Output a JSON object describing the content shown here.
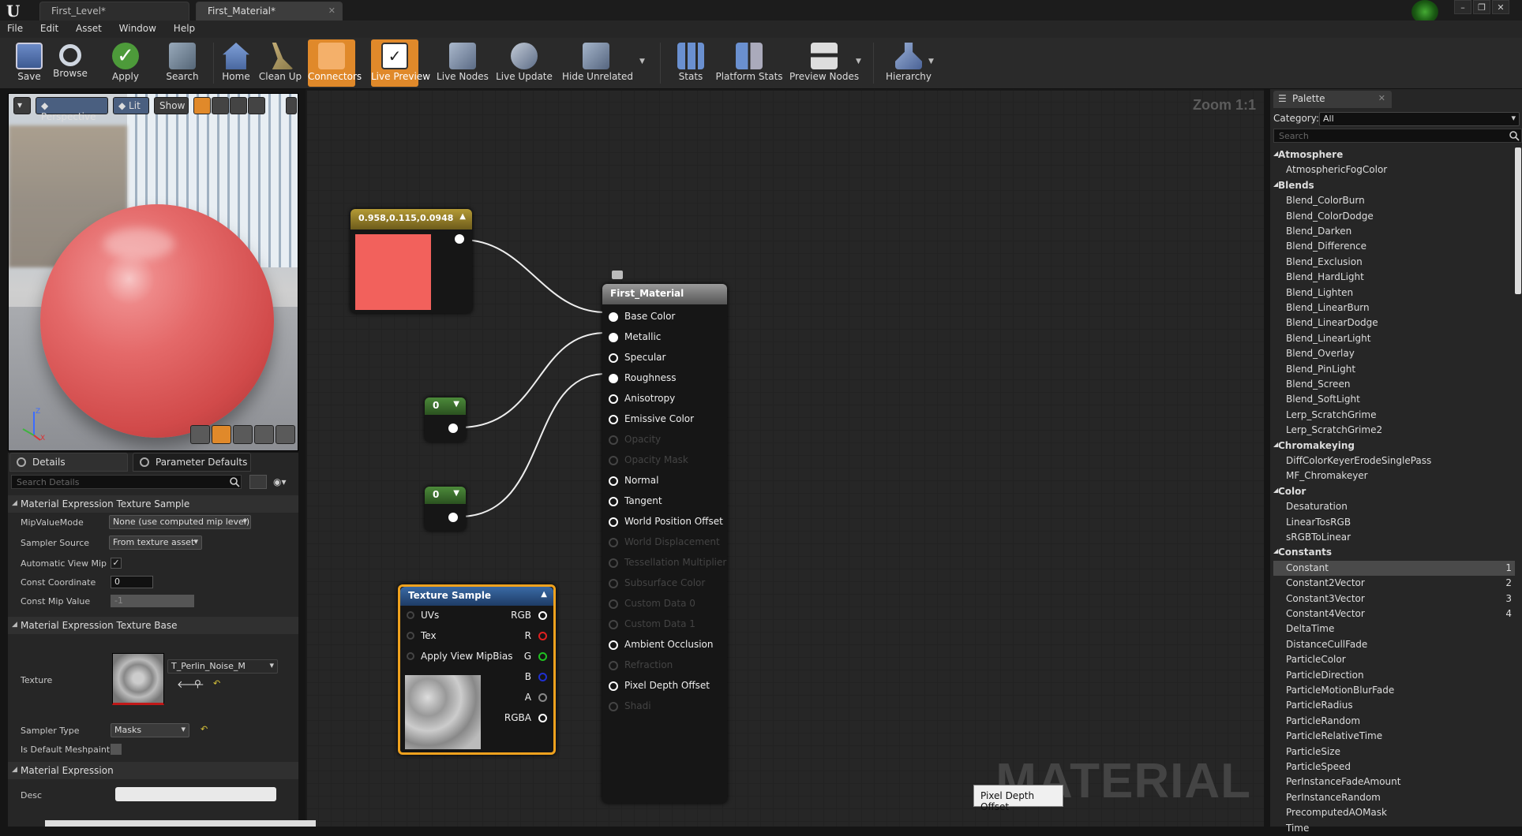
{
  "tabs": [
    {
      "label": "First_Level*"
    },
    {
      "label": "First_Material*"
    }
  ],
  "menu": [
    "File",
    "Edit",
    "Asset",
    "Window",
    "Help"
  ],
  "toolbar": {
    "save": "Save",
    "browse": "Browse",
    "apply": "Apply",
    "search": "Search",
    "home": "Home",
    "cleanup": "Clean Up",
    "connectors": "Connectors",
    "live_preview": "Live Preview",
    "live_nodes": "Live Nodes",
    "live_update": "Live Update",
    "hide_unrelated": "Hide Unrelated",
    "stats": "Stats",
    "platform_stats": "Platform Stats",
    "preview_nodes": "Preview Nodes",
    "hierarchy": "Hierarchy"
  },
  "viewport": {
    "perspective": "Perspective",
    "lit": "Lit",
    "show": "Show"
  },
  "details": {
    "tab_details": "Details",
    "tab_params": "Parameter Defaults",
    "search_placeholder": "Search Details",
    "sec_texture_sample": "Material Expression Texture Sample",
    "mip_value_mode": {
      "label": "MipValueMode",
      "value": "None (use computed mip level)"
    },
    "sampler_source": {
      "label": "Sampler Source",
      "value": "From texture asset"
    },
    "auto_view_mip": {
      "label": "Automatic View Mip E",
      "checked": "✓"
    },
    "const_coordinate": {
      "label": "Const Coordinate",
      "value": "0"
    },
    "const_mip_value": {
      "label": "Const Mip Value",
      "value": "-1"
    },
    "sec_texture_base": "Material Expression Texture Base",
    "texture": {
      "label": "Texture",
      "value": "T_Perlin_Noise_M"
    },
    "sampler_type": {
      "label": "Sampler Type",
      "value": "Masks"
    },
    "is_default_meshpaint": {
      "label": "Is Default Meshpaint"
    },
    "sec_material_expression": "Material Expression",
    "desc": {
      "label": "Desc"
    }
  },
  "graph": {
    "zoom": "Zoom 1:1",
    "watermark": "MATERIAL",
    "color_node_title": "0.958,0.115,0.0948",
    "constant_color": "#f2615c",
    "const1_value": "0",
    "const2_value": "0",
    "result_node": {
      "title": "First_Material",
      "pins": [
        {
          "label": "Base Color",
          "active": true,
          "connected": true
        },
        {
          "label": "Metallic",
          "active": true,
          "connected": true
        },
        {
          "label": "Specular",
          "active": true,
          "connected": false
        },
        {
          "label": "Roughness",
          "active": true,
          "connected": true
        },
        {
          "label": "Anisotropy",
          "active": true,
          "connected": false
        },
        {
          "label": "Emissive Color",
          "active": true,
          "connected": false
        },
        {
          "label": "Opacity",
          "active": false
        },
        {
          "label": "Opacity Mask",
          "active": false
        },
        {
          "label": "Normal",
          "active": true,
          "connected": false
        },
        {
          "label": "Tangent",
          "active": true,
          "connected": false
        },
        {
          "label": "World Position Offset",
          "active": true,
          "connected": false
        },
        {
          "label": "World Displacement",
          "active": false
        },
        {
          "label": "Tessellation Multiplier",
          "active": false
        },
        {
          "label": "Subsurface Color",
          "active": false
        },
        {
          "label": "Custom Data 0",
          "active": false
        },
        {
          "label": "Custom Data 1",
          "active": false
        },
        {
          "label": "Ambient Occlusion",
          "active": true,
          "connected": false
        },
        {
          "label": "Refraction",
          "active": false
        },
        {
          "label": "Pixel Depth Offset",
          "active": true,
          "connected": false
        },
        {
          "label": "Shadi",
          "active": false
        }
      ]
    },
    "texture_node": {
      "title": "Texture Sample",
      "inputs": [
        "UVs",
        "Tex",
        "Apply View MipBias"
      ],
      "outputs": [
        "RGB",
        "R",
        "G",
        "B",
        "A",
        "RGBA"
      ]
    },
    "tooltip": "Pixel Depth Offset"
  },
  "palette": {
    "tab": "Palette",
    "category_label": "Category:",
    "category_value": "All",
    "search_placeholder": "Search",
    "rows": [
      {
        "type": "cat",
        "label": "Atmosphere"
      },
      {
        "type": "item",
        "label": "AtmosphericFogColor"
      },
      {
        "type": "cat",
        "label": "Blends"
      },
      {
        "type": "item",
        "label": "Blend_ColorBurn"
      },
      {
        "type": "item",
        "label": "Blend_ColorDodge"
      },
      {
        "type": "item",
        "label": "Blend_Darken"
      },
      {
        "type": "item",
        "label": "Blend_Difference"
      },
      {
        "type": "item",
        "label": "Blend_Exclusion"
      },
      {
        "type": "item",
        "label": "Blend_HardLight"
      },
      {
        "type": "item",
        "label": "Blend_Lighten"
      },
      {
        "type": "item",
        "label": "Blend_LinearBurn"
      },
      {
        "type": "item",
        "label": "Blend_LinearDodge"
      },
      {
        "type": "item",
        "label": "Blend_LinearLight"
      },
      {
        "type": "item",
        "label": "Blend_Overlay"
      },
      {
        "type": "item",
        "label": "Blend_PinLight"
      },
      {
        "type": "item",
        "label": "Blend_Screen"
      },
      {
        "type": "item",
        "label": "Blend_SoftLight"
      },
      {
        "type": "item",
        "label": "Lerp_ScratchGrime"
      },
      {
        "type": "item",
        "label": "Lerp_ScratchGrime2"
      },
      {
        "type": "cat",
        "label": "Chromakeying"
      },
      {
        "type": "item",
        "label": "DiffColorKeyerErodeSinglePass"
      },
      {
        "type": "item",
        "label": "MF_Chromakeyer"
      },
      {
        "type": "cat",
        "label": "Color"
      },
      {
        "type": "item",
        "label": "Desaturation"
      },
      {
        "type": "item",
        "label": "LinearTosRGB"
      },
      {
        "type": "item",
        "label": "sRGBToLinear"
      },
      {
        "type": "cat",
        "label": "Constants"
      },
      {
        "type": "item",
        "label": "Constant",
        "hotkey": "1",
        "selected": true
      },
      {
        "type": "item",
        "label": "Constant2Vector",
        "hotkey": "2"
      },
      {
        "type": "item",
        "label": "Constant3Vector",
        "hotkey": "3"
      },
      {
        "type": "item",
        "label": "Constant4Vector",
        "hotkey": "4"
      },
      {
        "type": "item",
        "label": "DeltaTime"
      },
      {
        "type": "item",
        "label": "DistanceCullFade"
      },
      {
        "type": "item",
        "label": "ParticleColor"
      },
      {
        "type": "item",
        "label": "ParticleDirection"
      },
      {
        "type": "item",
        "label": "ParticleMotionBlurFade"
      },
      {
        "type": "item",
        "label": "ParticleRadius"
      },
      {
        "type": "item",
        "label": "ParticleRandom"
      },
      {
        "type": "item",
        "label": "ParticleRelativeTime"
      },
      {
        "type": "item",
        "label": "ParticleSize"
      },
      {
        "type": "item",
        "label": "ParticleSpeed"
      },
      {
        "type": "item",
        "label": "PerInstanceFadeAmount"
      },
      {
        "type": "item",
        "label": "PerInstanceRandom"
      },
      {
        "type": "item",
        "label": "PrecomputedAOMask"
      },
      {
        "type": "item",
        "label": "Time"
      }
    ]
  }
}
